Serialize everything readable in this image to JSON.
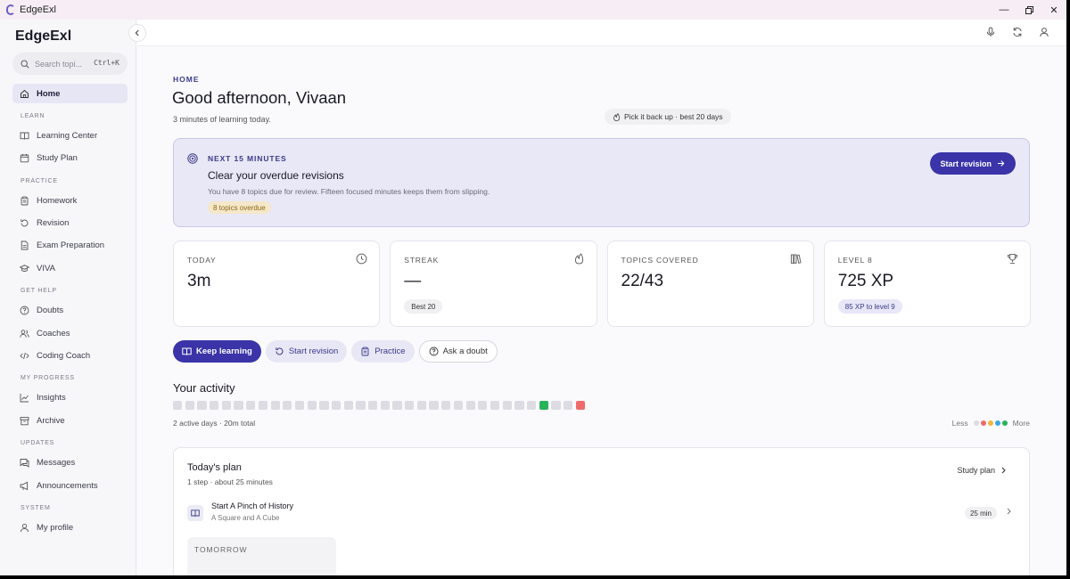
{
  "window": {
    "title": "EdgeExl",
    "controls": [
      "minimize",
      "restore",
      "close"
    ]
  },
  "sidebar": {
    "brand": "EdgeExl",
    "search": {
      "placeholder": "Search topi...",
      "shortcut": "Ctrl+K"
    },
    "home": {
      "label": "Home",
      "icon": "home-icon"
    },
    "sections": [
      {
        "title": "LEARN",
        "items": [
          {
            "label": "Learning Center",
            "icon": "book-icon"
          },
          {
            "label": "Study Plan",
            "icon": "calendar-icon"
          }
        ]
      },
      {
        "title": "PRACTICE",
        "items": [
          {
            "label": "Homework",
            "icon": "clipboard-icon"
          },
          {
            "label": "Revision",
            "icon": "rotate-icon"
          },
          {
            "label": "Exam Preparation",
            "icon": "document-icon"
          },
          {
            "label": "VIVA",
            "icon": "graduation-cap-icon"
          }
        ]
      },
      {
        "title": "GET HELP",
        "items": [
          {
            "label": "Doubts",
            "icon": "question-icon"
          },
          {
            "label": "Coaches",
            "icon": "users-icon"
          },
          {
            "label": "Coding Coach",
            "icon": "code-icon"
          }
        ]
      },
      {
        "title": "MY PROGRESS",
        "items": [
          {
            "label": "Insights",
            "icon": "chart-icon"
          },
          {
            "label": "Archive",
            "icon": "archive-icon"
          }
        ]
      },
      {
        "title": "UPDATES",
        "items": [
          {
            "label": "Messages",
            "icon": "message-icon"
          },
          {
            "label": "Announcements",
            "icon": "megaphone-icon"
          }
        ]
      },
      {
        "title": "SYSTEM",
        "items": [
          {
            "label": "My profile",
            "icon": "user-icon"
          }
        ]
      }
    ]
  },
  "topbar": {
    "icons": [
      "microphone-icon",
      "refresh-icon",
      "user-icon"
    ]
  },
  "main": {
    "breadcrumb": "HOME",
    "greeting": "Good afternoon, Vivaan",
    "subline": "3 minutes of learning today.",
    "streak_pill": "Pick it back up · best 20 days",
    "hero": {
      "eyebrow": "NEXT 15 MINUTES",
      "title": "Clear your overdue revisions",
      "description": "You have 8 topics due for review. Fifteen focused minutes keeps them from slipping.",
      "tag": "8 topics overdue",
      "cta": "Start revision"
    },
    "stats": [
      {
        "label": "TODAY",
        "value": "3m",
        "icon": "clock-icon",
        "badge": ""
      },
      {
        "label": "STREAK",
        "value": "—",
        "icon": "flame-icon",
        "badge": "Best 20"
      },
      {
        "label": "TOPICS COVERED",
        "value": "22/43",
        "icon": "books-icon",
        "badge": ""
      },
      {
        "label": "LEVEL 8",
        "value": "725 XP",
        "icon": "trophy-icon",
        "badge": "85 XP to level 9"
      }
    ],
    "actions": [
      {
        "label": "Keep learning",
        "icon": "book-open-icon",
        "style": "primary"
      },
      {
        "label": "Start revision",
        "icon": "rotate-icon",
        "style": "soft"
      },
      {
        "label": "Practice",
        "icon": "clipboard-icon",
        "style": "soft"
      },
      {
        "label": "Ask a doubt",
        "icon": "question-icon",
        "style": "outline"
      }
    ],
    "activity": {
      "title": "Your activity",
      "cells": [
        "empty",
        "empty",
        "empty",
        "empty",
        "empty",
        "empty",
        "empty",
        "empty",
        "empty",
        "empty",
        "empty",
        "empty",
        "empty",
        "empty",
        "empty",
        "empty",
        "empty",
        "empty",
        "empty",
        "empty",
        "empty",
        "empty",
        "empty",
        "empty",
        "empty",
        "empty",
        "empty",
        "empty",
        "empty",
        "empty",
        "green",
        "empty",
        "empty",
        "red"
      ],
      "summary": "2 active days · 20m total",
      "legend_less": "Less",
      "legend_more": "More",
      "legend_colors": [
        "#dcdce2",
        "#ef6b6b",
        "#f2b53d",
        "#3ba8e0",
        "#27b35a"
      ],
      "cell_colors": {
        "empty": "#dcdce2",
        "green": "#27b35a",
        "red": "#ef6b6b"
      }
    },
    "plan": {
      "title": "Today's plan",
      "meta": "1 step · about 25 minutes",
      "link": "Study plan",
      "items": [
        {
          "title": "Start A Pinch of History",
          "subtitle": "A Square and A Cube",
          "duration": "25 min"
        }
      ],
      "tomorrow_label": "TOMORROW"
    }
  },
  "colors": {
    "accent": "#3a34a8",
    "hero_bg": "#e9e8f6",
    "overdue_tag_bg": "#f5e7c8"
  }
}
